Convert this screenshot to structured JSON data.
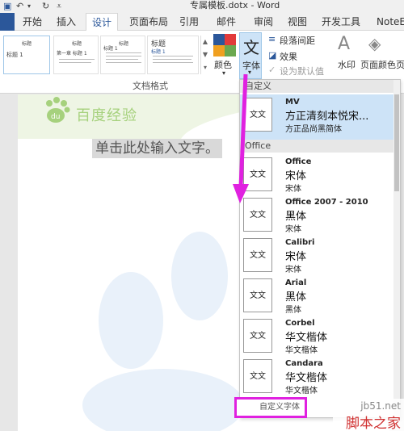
{
  "titlebar": {
    "title": "专属模板.dotx - Word",
    "undo": "5",
    "redo": "↻"
  },
  "tabs": [
    {
      "label": "开始"
    },
    {
      "label": "插入"
    },
    {
      "label": "设计"
    },
    {
      "label": "页面布局"
    },
    {
      "label": "引用"
    },
    {
      "label": "邮件"
    },
    {
      "label": "审阅"
    },
    {
      "label": "视图"
    },
    {
      "label": "开发工具"
    },
    {
      "label": "NoteEx"
    }
  ],
  "ribbon": {
    "thumbs": [
      {
        "heading": "标题",
        "sub": "标题 1"
      },
      {
        "heading": "标题",
        "sub": "第一章 标题 1"
      },
      {
        "heading": "标题",
        "sub": "标题 1"
      },
      {
        "heading": "标题",
        "sub": "标题 1"
      }
    ],
    "group_label": "文档格式",
    "colors_label": "颜色",
    "font_button_glyph": "文",
    "font_button_label": "字体",
    "paragraph_spacing_label": "段落间距",
    "effects_label": "效果",
    "set_default_label": "设为默认值",
    "watermark_label": "水印",
    "page_color_label": "页面颜色",
    "page_more_label": "页"
  },
  "document": {
    "header_text": "百度经验",
    "placeholder_text": "单击此处输入文字。"
  },
  "dropdown": {
    "custom_section": "自定义",
    "office_section": "Office",
    "preview_glyph": "文文",
    "items": [
      {
        "name": "MV",
        "heading": "方正清刻本悦宋...",
        "body": "方正品尚黑简体"
      },
      {
        "name": "Office",
        "heading": "宋体",
        "body": "宋体"
      },
      {
        "name": "Office 2007 - 2010",
        "heading": "黑体",
        "body": "宋体"
      },
      {
        "name": "Calibri",
        "heading": "宋体",
        "body": "宋体"
      },
      {
        "name": "Arial",
        "heading": "黑体",
        "body": "黑体"
      },
      {
        "name": "Corbel",
        "heading": "华文楷体",
        "body": "华文楷体"
      },
      {
        "name": "Candara",
        "heading": "华文楷体",
        "body": "华文楷体"
      }
    ],
    "customize_label": "自定义字体"
  },
  "watermark": {
    "site": "jb51.net",
    "brand": "脚本之家"
  },
  "colors": {
    "accent": "#2b579a",
    "highlight": "#cde3f7",
    "annotation": "#e021e0",
    "header_green": "#a6d17d"
  }
}
